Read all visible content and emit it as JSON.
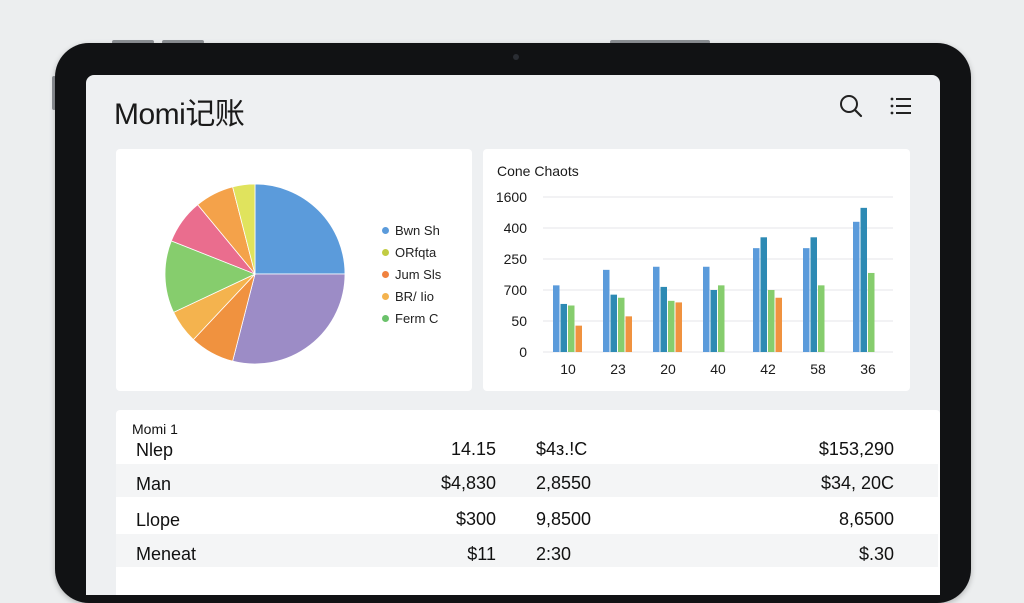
{
  "app": {
    "title": "Momi记账"
  },
  "header": {
    "search_icon": "search-icon",
    "menu_icon": "list-menu-icon"
  },
  "colors": {
    "blue": "#5b9bdb",
    "purple": "#9c8cc6",
    "orange": "#f0923f",
    "amber": "#f4b34e",
    "green": "#86cd6d",
    "pink": "#ea6d8e",
    "yellow": "#e0e35d",
    "teal": "#2d8ab4"
  },
  "legend": [
    {
      "label": "Bwn Sh",
      "color": "#5b9bdb"
    },
    {
      "label": "ORfqta",
      "color": "#c1cc43"
    },
    {
      "label": "Jum Sls",
      "color": "#f0823f"
    },
    {
      "label": "BR/ Iio",
      "color": "#f4b34e"
    },
    {
      "label": "Ferm C",
      "color": "#6bc26b"
    }
  ],
  "chart_data": [
    {
      "type": "pie",
      "slices": [
        {
          "label": "Bwn Sh",
          "value": 25,
          "color": "#5b9bdb"
        },
        {
          "label": "",
          "value": 29,
          "color": "#9c8cc6"
        },
        {
          "label": "",
          "value": 8,
          "color": "#f0923f"
        },
        {
          "label": "",
          "value": 6,
          "color": "#f4b34e"
        },
        {
          "label": "",
          "value": 13,
          "color": "#86cd6d"
        },
        {
          "label": "",
          "value": 8,
          "color": "#ea6d8e"
        },
        {
          "label": "",
          "value": 7,
          "color": "#f4a24a"
        },
        {
          "label": "",
          "value": 4,
          "color": "#e0e35d"
        }
      ]
    },
    {
      "type": "bar",
      "title": "Cone Chaots",
      "categories": [
        "10",
        "23",
        "20",
        "40",
        "42",
        "58",
        "36"
      ],
      "ytick_labels": [
        "0",
        "50",
        "700",
        "250",
        "400",
        "1600"
      ],
      "series": [
        {
          "values": [
            4.3,
            5.3,
            5.5,
            5.5,
            6.7,
            6.7,
            8.4
          ],
          "color": "#5b9bdb"
        },
        {
          "values": [
            3.1,
            3.7,
            4.2,
            4.0,
            7.4,
            7.4,
            9.3
          ],
          "color": "#2d8ab4"
        },
        {
          "values": [
            3.0,
            3.5,
            3.3,
            4.3,
            4.0,
            4.3,
            5.1
          ],
          "color": "#86cd6d"
        },
        {
          "values": [
            1.7,
            2.3,
            3.2,
            0,
            3.5,
            0,
            0
          ],
          "color": "#f0923f"
        }
      ],
      "ylim": [
        0,
        10
      ]
    }
  ],
  "table": {
    "header": "Momi 1",
    "rows": [
      {
        "label": "Nlep",
        "c1": "14.15",
        "c2": "$4з.!C",
        "c3": "$153,290"
      },
      {
        "label": "Man",
        "c1": "$4,830",
        "c2": "2,8550",
        "c3": "$34, 20C"
      },
      {
        "label": "Llope",
        "c1": "$300",
        "c2": "9,8500",
        "c3": "8,6500"
      },
      {
        "label": "Meneat",
        "c1": "$11",
        "c2": "2:30",
        "c3": "$.30"
      }
    ]
  }
}
